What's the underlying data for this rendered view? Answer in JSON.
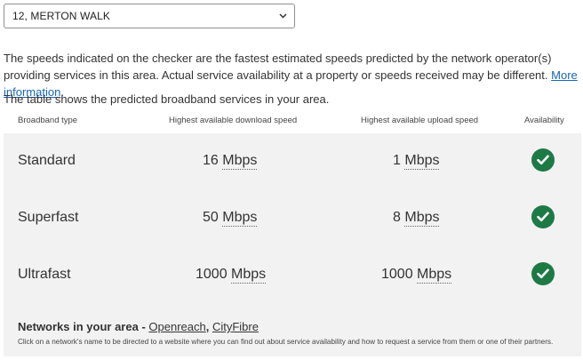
{
  "address": {
    "selected": "12, MERTON WALK",
    "icon": "chevron-down-icon"
  },
  "intro": {
    "text": "The speeds indicated on the checker are the fastest estimated speeds predicted by the network operator(s) providing services in this area. Actual service availability at a property or speeds received may be different.",
    "link_label": "More information",
    "trailing": "."
  },
  "table_caption": "The table shows the predicted broadband services in your area.",
  "columns": {
    "type": "Broadband type",
    "download": "Highest available download speed",
    "upload": "Highest available upload speed",
    "availability": "Availability"
  },
  "rows": [
    {
      "type": "Standard",
      "download_value": "16",
      "download_unit": "Mbps",
      "upload_value": "1",
      "upload_unit": "Mbps",
      "available": true
    },
    {
      "type": "Superfast",
      "download_value": "50",
      "download_unit": "Mbps",
      "upload_value": "8",
      "upload_unit": "Mbps",
      "available": true
    },
    {
      "type": "Ultrafast",
      "download_value": "1000",
      "download_unit": "Mbps",
      "upload_value": "1000",
      "upload_unit": "Mbps",
      "available": true
    }
  ],
  "networks": {
    "heading": "Networks in your area - ",
    "providers": [
      "Openreach",
      "CityFibre"
    ],
    "separator": ", ",
    "note": "Click on a network's name to be directed to a website where you can find out about service availability and how to request a service from them or one of their partners."
  },
  "colors": {
    "check": "#1d7a45",
    "link": "#1a66b3",
    "table_bg": "#f2f2f2"
  }
}
